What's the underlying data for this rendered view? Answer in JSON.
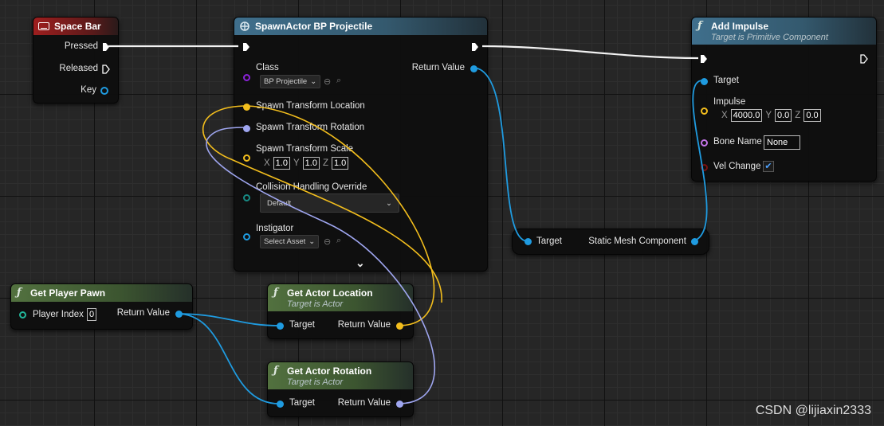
{
  "spacebar": {
    "title": "Space Bar",
    "pressed": "Pressed",
    "released": "Released",
    "key": "Key"
  },
  "spawn": {
    "title": "SpawnActor BP Projectile",
    "class": "Class",
    "class_value": "BP Projectile",
    "return_value": "Return Value",
    "loc": "Spawn Transform Location",
    "rot": "Spawn Transform Rotation",
    "scale": "Spawn Transform Scale",
    "scale_x": "1.0",
    "scale_y": "1.0",
    "scale_z": "1.0",
    "collision": "Collision Handling Override",
    "collision_value": "Default",
    "instigator": "Instigator",
    "instigator_value": "Select Asset"
  },
  "impulse": {
    "title": "Add Impulse",
    "subtitle": "Target is Primitive Component",
    "target": "Target",
    "impulse": "Impulse",
    "x": "4000.0",
    "y": "0.0",
    "z": "0.0",
    "bone": "Bone Name",
    "bone_value": "None",
    "vel": "Vel Change",
    "vel_checked": true
  },
  "mesh": {
    "target": "Target",
    "out": "Static Mesh Component"
  },
  "pawn": {
    "title": "Get Player Pawn",
    "index": "Player Index",
    "index_value": "0",
    "return_value": "Return Value"
  },
  "loc": {
    "title": "Get Actor Location",
    "subtitle": "Target is Actor",
    "target": "Target",
    "return_value": "Return Value"
  },
  "rot": {
    "title": "Get Actor Rotation",
    "subtitle": "Target is Actor",
    "target": "Target",
    "return_value": "Return Value"
  },
  "axis": {
    "x": "X",
    "y": "Y",
    "z": "Z"
  },
  "icons": [
    "keyboard-icon",
    "function-icon",
    "exec-pin-icon",
    "search-icon",
    "chevron-down-icon"
  ],
  "watermark": "CSDN @lijiaxin2333",
  "colors": {
    "exec": "#ffffff",
    "object": "#1f9be0",
    "vector": "#f3be1d",
    "rotator": "#9fa6f0"
  }
}
